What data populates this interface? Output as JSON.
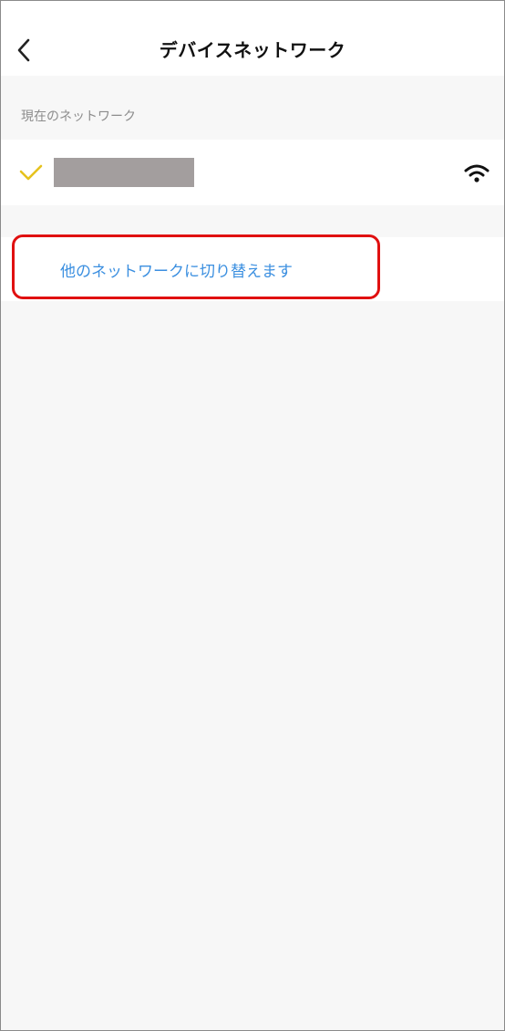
{
  "header": {
    "title": "デバイスネットワーク",
    "back_icon": "chevron-left-icon"
  },
  "current_network": {
    "section_label": "現在のネットワーク",
    "name": "",
    "check_icon": "checkmark-icon",
    "signal_icon": "wifi-icon"
  },
  "actions": {
    "switch_network_label": "他のネットワークに切り替えます"
  },
  "colors": {
    "accent_check": "#e6c21e",
    "link_blue": "#3b8fe0",
    "highlight_red": "#e01010",
    "background": "#f7f7f7"
  }
}
